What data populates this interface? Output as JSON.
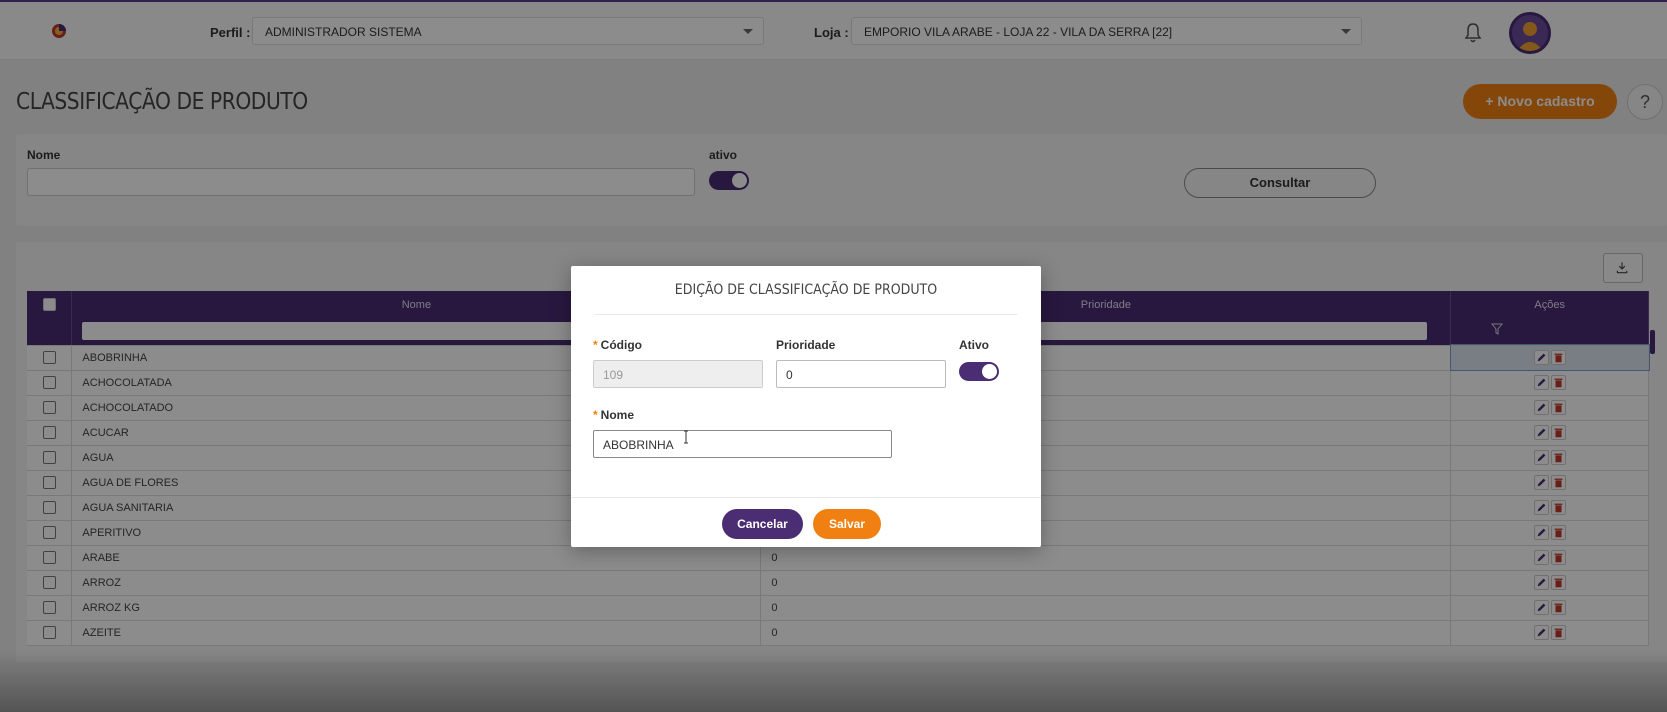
{
  "header": {
    "perfil_label": "Perfil :",
    "perfil_value": "ADMINISTRADOR SISTEMA",
    "loja_label": "Loja :",
    "loja_value": "EMPORIO VILA ARABE - LOJA 22 - VILA DA SERRA [22]",
    "icons": [
      "logo-icon",
      "bell-icon",
      "avatar-icon"
    ]
  },
  "page": {
    "title": "CLASSIFICAÇÃO DE PRODUTO",
    "new_button": "Novo cadastro",
    "help_button": "?"
  },
  "filters": {
    "nome_label": "Nome",
    "nome_value": "",
    "ativo_label": "ativo",
    "ativo_on": true,
    "consultar_button": "Consultar"
  },
  "grid": {
    "columns": [
      "Nome",
      "Prioridade",
      "Ações"
    ],
    "rows": [
      {
        "nome": "ABOBRINHA",
        "prioridade": ""
      },
      {
        "nome": "ACHOCOLATADA",
        "prioridade": ""
      },
      {
        "nome": "ACHOCOLATADO",
        "prioridade": ""
      },
      {
        "nome": "ACUCAR",
        "prioridade": ""
      },
      {
        "nome": "AGUA",
        "prioridade": ""
      },
      {
        "nome": "AGUA DE FLORES",
        "prioridade": ""
      },
      {
        "nome": "AGUA SANITARIA",
        "prioridade": ""
      },
      {
        "nome": "APERITIVO",
        "prioridade": ""
      },
      {
        "nome": "ARABE",
        "prioridade": "0"
      },
      {
        "nome": "ARROZ",
        "prioridade": "0"
      },
      {
        "nome": "ARROZ KG",
        "prioridade": "0"
      },
      {
        "nome": "AZEITE",
        "prioridade": "0"
      }
    ]
  },
  "modal": {
    "title": "EDIÇÃO DE CLASSIFICAÇÃO DE PRODUTO",
    "codigo_label": "Código",
    "codigo_value": "109",
    "prioridade_label": "Prioridade",
    "prioridade_value": "0",
    "ativo_label": "Ativo",
    "ativo_on": true,
    "nome_label": "Nome",
    "nome_value": "ABOBRINHA",
    "required_mark": "*",
    "cancel_button": "Cancelar",
    "save_button": "Salvar"
  },
  "colors": {
    "primary": "#4a2d73",
    "accent": "#f08012"
  }
}
